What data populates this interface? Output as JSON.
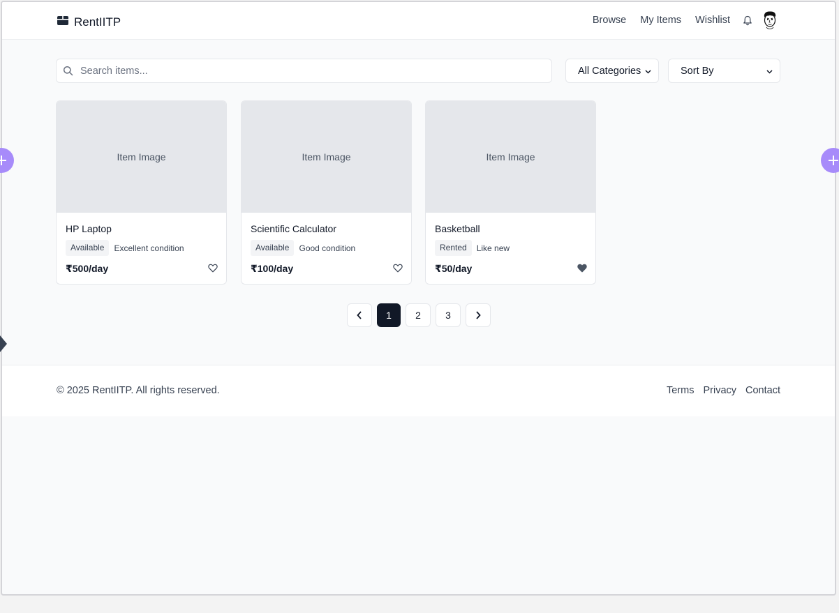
{
  "header": {
    "brand": "RentIITP",
    "nav": [
      "Browse",
      "My Items",
      "Wishlist"
    ]
  },
  "filters": {
    "search_placeholder": "Search items...",
    "category": "All Categories",
    "sort": "Sort By"
  },
  "items": [
    {
      "image_label": "Item Image",
      "name": "HP Laptop",
      "status": "Available",
      "condition": "Excellent condition",
      "price": "₹500/day",
      "wishlisted": false
    },
    {
      "image_label": "Item Image",
      "name": "Scientific Calculator",
      "status": "Available",
      "condition": "Good condition",
      "price": "₹100/day",
      "wishlisted": false
    },
    {
      "image_label": "Item Image",
      "name": "Basketball",
      "status": "Rented",
      "condition": "Like new",
      "price": "₹50/day",
      "wishlisted": true
    }
  ],
  "pagination": {
    "pages": [
      "1",
      "2",
      "3"
    ],
    "current": "1"
  },
  "footer": {
    "copyright": "© 2025 RentIITP. All rights reserved.",
    "links": [
      "Terms",
      "Privacy",
      "Contact"
    ]
  },
  "colors": {
    "accent_dark": "#111827",
    "side_button": "#a78bfa"
  }
}
